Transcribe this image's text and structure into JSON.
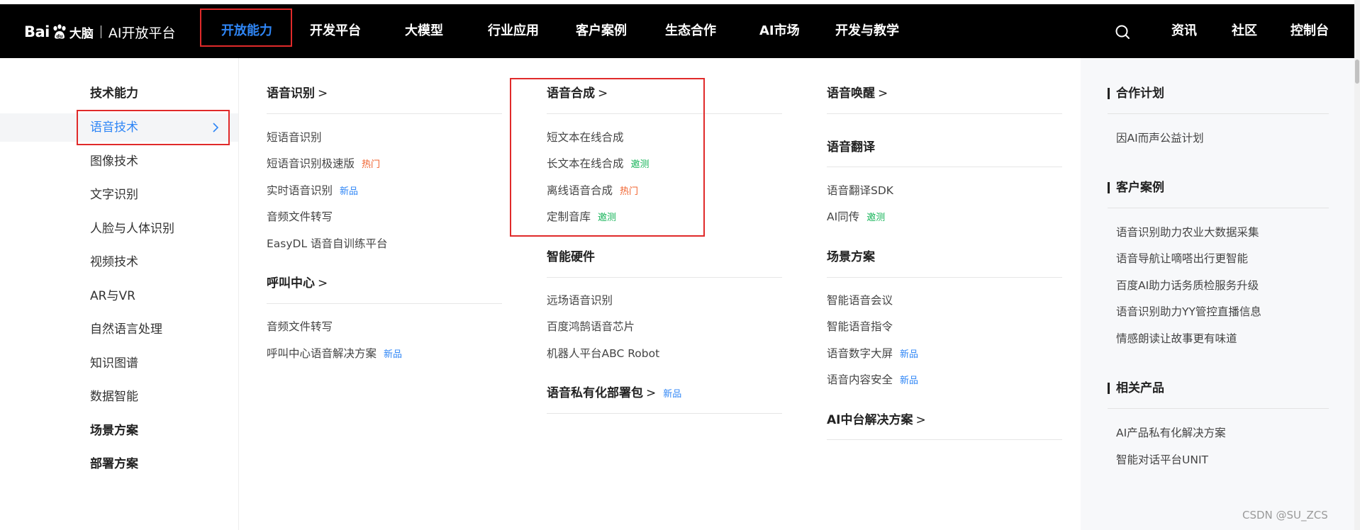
{
  "header": {
    "logo": {
      "brand": "Bai",
      "brand_tail": "du",
      "brand2": "大脑",
      "platform": "AI开放平台"
    },
    "nav": [
      "开放能力",
      "开发平台",
      "大模型",
      "行业应用",
      "客户案例",
      "生态合作",
      "AI市场",
      "开发与教学"
    ],
    "right_links": [
      "资讯",
      "社区",
      "控制台"
    ],
    "active_color": "#2f86f6"
  },
  "left_menu": {
    "heading": "技术能力",
    "items": [
      "语音技术",
      "图像技术",
      "文字识别",
      "人脸与人体识别",
      "视频技术",
      "AR与VR",
      "自然语言处理",
      "知识图谱",
      "数据智能"
    ],
    "footer_items": [
      "场景方案",
      "部署方案"
    ]
  },
  "columns": {
    "asr": {
      "title": "语音识别",
      "arrow": ">",
      "links": [
        {
          "text": "短语音识别",
          "tag": ""
        },
        {
          "text": "短语音识别极速版",
          "tag": "热门"
        },
        {
          "text": "实时语音识别",
          "tag": "新品"
        },
        {
          "text": "音频文件转写",
          "tag": ""
        },
        {
          "text": "EasyDL 语音自训练平台",
          "tag": ""
        }
      ]
    },
    "callcenter": {
      "title": "呼叫中心",
      "arrow": ">",
      "links": [
        {
          "text": "音频文件转写",
          "tag": ""
        },
        {
          "text": "呼叫中心语音解决方案",
          "tag": "新品"
        }
      ]
    },
    "tts": {
      "title": "语音合成",
      "arrow": ">",
      "links": [
        {
          "text": "短文本在线合成",
          "tag": ""
        },
        {
          "text": "长文本在线合成",
          "tag": "邀测"
        },
        {
          "text": "离线语音合成",
          "tag": "热门"
        },
        {
          "text": "定制音库",
          "tag": "邀测"
        }
      ]
    },
    "hardware": {
      "title": "智能硬件",
      "links": [
        {
          "text": "远场语音识别",
          "tag": ""
        },
        {
          "text": "百度鸿鹄语音芯片",
          "tag": ""
        },
        {
          "text": "机器人平台ABC Robot",
          "tag": ""
        }
      ]
    },
    "private": {
      "title": "语音私有化部署包",
      "arrow": ">",
      "tag": "新品"
    },
    "wakeup": {
      "title": "语音唤醒",
      "arrow": ">"
    },
    "translate": {
      "title": "语音翻译",
      "links": [
        {
          "text": "语音翻译SDK",
          "tag": ""
        },
        {
          "text": "AI同传",
          "tag": "邀测"
        }
      ]
    },
    "scene": {
      "title": "场景方案",
      "links": [
        {
          "text": "智能语音会议",
          "tag": ""
        },
        {
          "text": "智能语音指令",
          "tag": ""
        },
        {
          "text": "语音数字大屏",
          "tag": "新品"
        },
        {
          "text": "语音内容安全",
          "tag": "新品"
        }
      ]
    },
    "aicenter": {
      "title": "AI中台解决方案",
      "arrow": ">"
    }
  },
  "right_panel": {
    "sections": [
      {
        "title": "合作计划",
        "links": [
          "因AI而声公益计划"
        ]
      },
      {
        "title": "客户案例",
        "links": [
          "语音识别助力农业大数据采集",
          "语音导航让嘀嗒出行更智能",
          "百度AI助力话务质检服务升级",
          "语音识别助力YY管控直播信息",
          "情感朗读让故事更有味道"
        ]
      },
      {
        "title": "相关产品",
        "links": [
          "AI产品私有化解决方案",
          "智能对话平台UNIT"
        ]
      }
    ]
  },
  "watermark": "CSDN @SU_ZCS",
  "colors": {
    "hot": "#f0602b",
    "new": "#2f86f6",
    "beta": "#19b55b",
    "highlight_box": "#e02a2a"
  }
}
